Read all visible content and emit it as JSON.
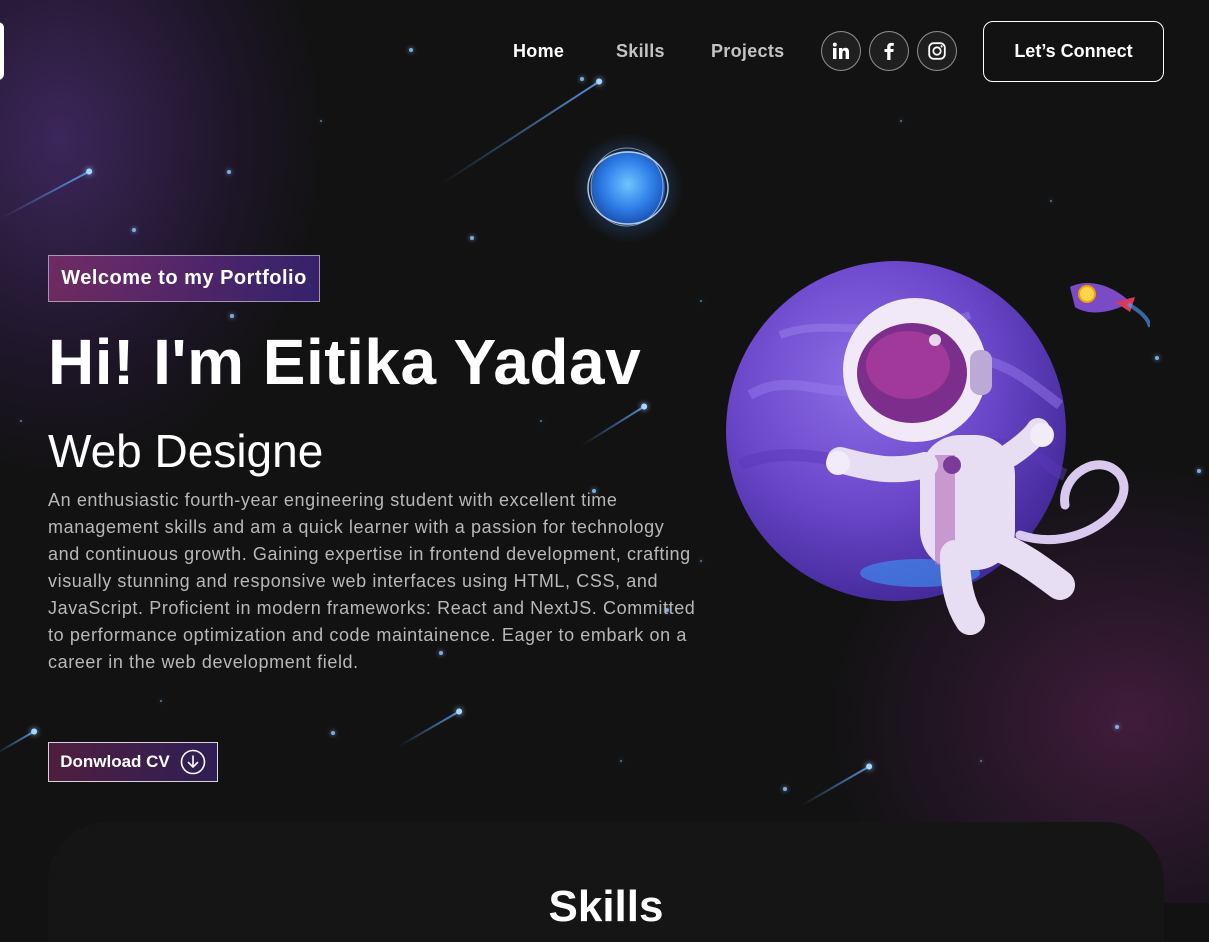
{
  "nav": {
    "links": [
      "Home",
      "Skills",
      "Projects"
    ],
    "active": "Home",
    "social": [
      "linkedin-icon",
      "facebook-icon",
      "instagram-icon"
    ],
    "connect_label": "Let’s Connect"
  },
  "hero": {
    "tagline": "Welcome to my Portfolio",
    "title": "Hi! I'm Eitika Yadav",
    "subtitle": "Web Designe",
    "bio": "An enthusiastic fourth-year engineering student with excellent time management skills and am a quick learner with a passion for technology and continuous growth. Gaining expertise in frontend development, crafting visually stunning and responsive web interfaces using HTML, CSS, and JavaScript. Proficient in modern frameworks: React and NextJS. Committed to performance optimization and code maintainence. Eager to embark on a career in the web development field.",
    "cv_label": "Donwload CV"
  },
  "skills": {
    "title": "Skills"
  },
  "colors": {
    "background": "#121212",
    "accent_pink": "#AA367C",
    "accent_purple": "#4A2FBD"
  }
}
